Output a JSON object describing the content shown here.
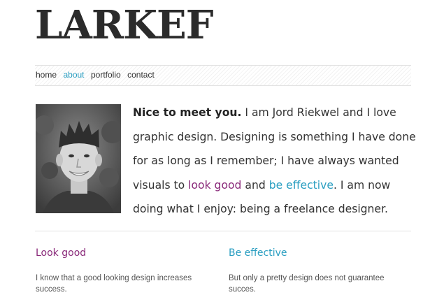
{
  "brand": {
    "logo_text": "LARKEF"
  },
  "nav": {
    "items": [
      {
        "label": "home"
      },
      {
        "label": "about",
        "active": true
      },
      {
        "label": "portfolio"
      },
      {
        "label": "contact"
      }
    ]
  },
  "intro": {
    "greeting": "Nice to meet you.",
    "text_1": " I am Jord Riekwel and I love",
    "text_2": "graphic design. Designing is something I have done",
    "text_3": "for as long as I remember; I have always wanted",
    "text_4": "visuals to ",
    "highlight_1": "look good",
    "and_word": " and ",
    "highlight_2": "be effective",
    "text_5": ". I am now",
    "text_6": "doing what I enjoy: being a freelance designer."
  },
  "columns": [
    {
      "heading": "Look good",
      "body": "I know that a good looking design increases success."
    },
    {
      "heading": "Be effective",
      "body": "But only a pretty design does not guarantee succes."
    }
  ],
  "colors": {
    "accent_purple": "#8a2a7a",
    "accent_blue": "#2a9ec1",
    "text": "#333333"
  }
}
